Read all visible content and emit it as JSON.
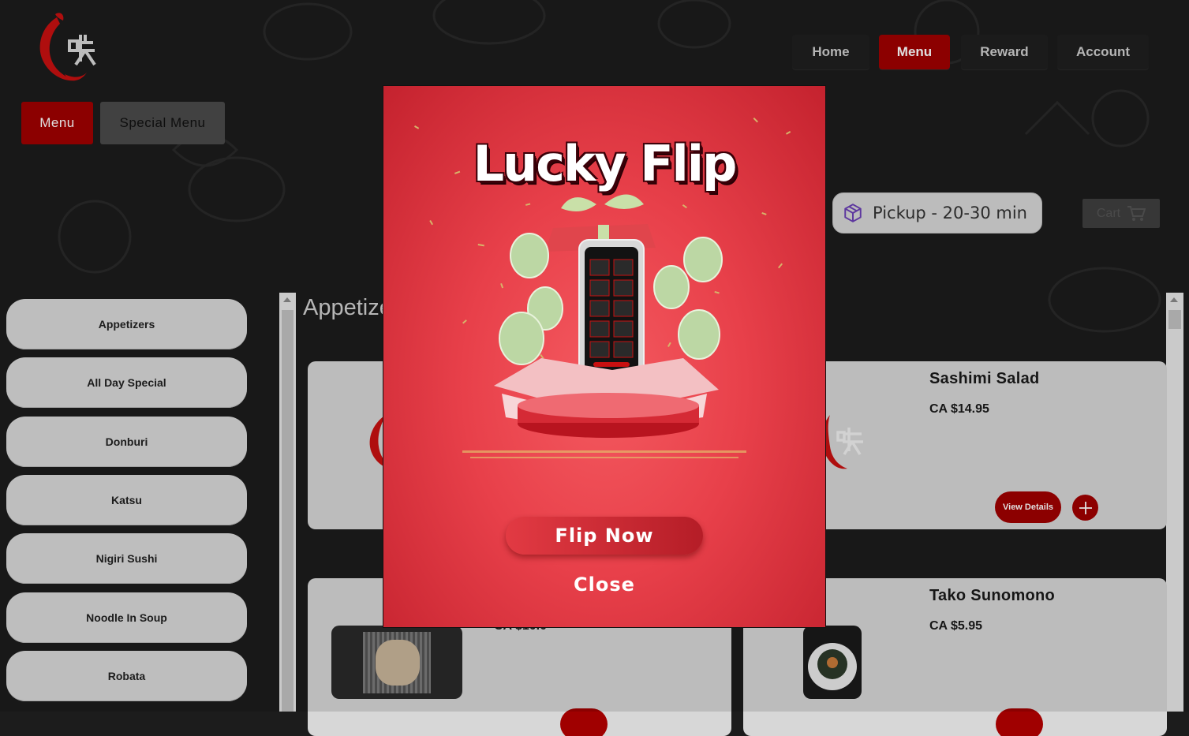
{
  "nav": {
    "home": "Home",
    "menu": "Menu",
    "reward": "Reward",
    "account": "Account"
  },
  "subtabs": {
    "menu": "Menu",
    "special": "Special Menu"
  },
  "pickup": {
    "label": "Pickup - 20-30 min",
    "icon": "box-icon"
  },
  "cart": {
    "label": "Cart",
    "icon": "cart-icon"
  },
  "sidebar": {
    "items": [
      {
        "label": "Appetizers"
      },
      {
        "label": "All Day Special"
      },
      {
        "label": "Donburi"
      },
      {
        "label": "Katsu"
      },
      {
        "label": "Nigiri Sushi"
      },
      {
        "label": "Noodle In Soup"
      },
      {
        "label": "Robata"
      }
    ]
  },
  "main": {
    "section_title": "Appetizers",
    "products": [
      {
        "name": "Sashimi Salad",
        "price": "CA $14.95",
        "details_label": "View Details"
      },
      {
        "name": "Tako Sunomono",
        "price": "CA $5.95"
      },
      {
        "price_partial": "CA $10.0"
      }
    ]
  },
  "modal": {
    "title": "Lucky Flip",
    "flip_button": "Flip Now",
    "close_button": "Close"
  },
  "colors": {
    "brand_red": "#a00000",
    "modal_red": "#e8404a",
    "background": "#1c1c1c"
  }
}
